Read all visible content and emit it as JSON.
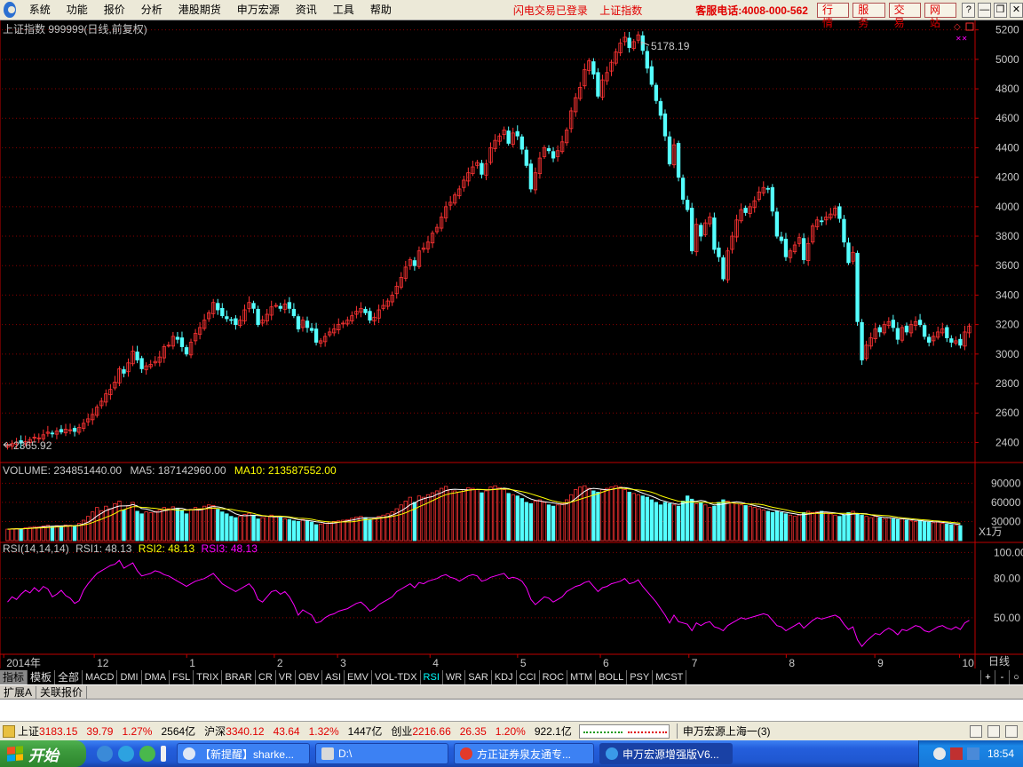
{
  "menu": {
    "items": [
      "系统",
      "功能",
      "报价",
      "分析",
      "港股期货",
      "申万宏源",
      "资讯",
      "工具",
      "帮助"
    ],
    "status_login": "闪电交易已登录",
    "status_index": "上证指数",
    "hotline": "客服电话:4008-000-562",
    "quick": [
      "行情",
      "服务",
      "交易",
      "网站"
    ],
    "window_buttons": [
      "?",
      "—",
      "❐",
      "✕"
    ]
  },
  "chart_header": {
    "title": "上证指数 999999(日线,前复权)",
    "high_label": "5178.19",
    "low_label": "2365.92",
    "volume_line": {
      "vol": "VOLUME: 234851440.00",
      "ma5": "MA5: 187142960.00",
      "ma10": "MA10: 213587552.00"
    },
    "rsi_line": {
      "name": "RSI(14,14,14)",
      "rsi1": "RSI1: 48.13",
      "rsi2": "RSI2: 48.13",
      "rsi3": "RSI3: 48.13"
    },
    "vol_unit": "X1万",
    "period": "日线"
  },
  "colors": {
    "up": "#ff3333",
    "down": "#54ffff",
    "grid": "#8b0000",
    "axis": "#c00000",
    "ma5": "#ffffff",
    "ma10": "#ffff00",
    "rsi": "#ff00ff"
  },
  "chart_data": [
    {
      "type": "candlestick",
      "title": "上证指数 999999(日线,前复权)",
      "y_ticks": [
        2400,
        2600,
        2800,
        3000,
        3200,
        3400,
        3600,
        3800,
        4000,
        4200,
        4400,
        4600,
        4800,
        5000,
        5200
      ],
      "ylim": [
        2270,
        5240
      ],
      "x_labels": [
        "2014年",
        "12",
        "1",
        "2",
        "3",
        "4",
        "5",
        "6",
        "7",
        "8",
        "9",
        "10"
      ],
      "high": 5178.19,
      "low": 2365.92,
      "closes": [
        2380,
        2392,
        2402,
        2396,
        2405,
        2420,
        2436,
        2431,
        2452,
        2470,
        2462,
        2478,
        2471,
        2490,
        2486,
        2475,
        2502,
        2530,
        2560,
        2590,
        2640,
        2680,
        2730,
        2760,
        2810,
        2900,
        2870,
        2940,
        3020,
        2960,
        2900,
        2920,
        2930,
        2950,
        2980,
        3050,
        3060,
        3120,
        3100,
        3050,
        3000,
        3080,
        3140,
        3180,
        3230,
        3280,
        3350,
        3300,
        3260,
        3240,
        3230,
        3200,
        3230,
        3300,
        3350,
        3310,
        3200,
        3230,
        3270,
        3320,
        3330,
        3310,
        3340,
        3310,
        3260,
        3170,
        3230,
        3180,
        3160,
        3080,
        3090,
        3120,
        3150,
        3170,
        3200,
        3210,
        3230,
        3260,
        3290,
        3310,
        3280,
        3230,
        3250,
        3300,
        3330,
        3360,
        3400,
        3460,
        3520,
        3590,
        3640,
        3600,
        3700,
        3720,
        3760,
        3820,
        3860,
        3930,
        4000,
        4030,
        4080,
        4120,
        4180,
        4230,
        4270,
        4300,
        4220,
        4290,
        4400,
        4450,
        4480,
        4520,
        4430,
        4500,
        4480,
        4390,
        4280,
        4120,
        4230,
        4330,
        4400,
        4380,
        4330,
        4380,
        4440,
        4520,
        4650,
        4740,
        4810,
        4930,
        4990,
        4900,
        4750,
        4860,
        4910,
        4980,
        5050,
        5110,
        5150,
        5080,
        5120,
        5166,
        5060,
        4940,
        4830,
        4720,
        4620,
        4480,
        4290,
        4420,
        4200,
        4050,
        3980,
        3700,
        3880,
        3800,
        3890,
        3930,
        3710,
        3660,
        3510,
        3700,
        3800,
        3910,
        3980,
        3960,
        4000,
        4040,
        4100,
        4130,
        4120,
        3970,
        3800,
        3770,
        3660,
        3700,
        3740,
        3790,
        3640,
        3750,
        3870,
        3910,
        3900,
        3930,
        3950,
        3990,
        3920,
        3760,
        3620,
        3690,
        3220,
        2960,
        3060,
        3110,
        3170,
        3150,
        3200,
        3220,
        3180,
        3100,
        3180,
        3150,
        3200,
        3220,
        3200,
        3120,
        3080,
        3120,
        3150,
        3170,
        3110,
        3080,
        3090,
        3060,
        3150,
        3190
      ]
    },
    {
      "type": "bar",
      "title": "VOLUME",
      "y_ticks": [
        30000,
        60000,
        90000
      ],
      "ylim": [
        0,
        96000
      ],
      "unit": "X1万",
      "values": [
        18000,
        18500,
        19000,
        18200,
        20000,
        21000,
        22000,
        21500,
        23000,
        24000,
        22000,
        23500,
        22800,
        24500,
        24000,
        23000,
        27000,
        32000,
        38000,
        45000,
        52000,
        47000,
        54000,
        50000,
        58000,
        62000,
        48000,
        55000,
        60000,
        46000,
        42000,
        45000,
        44000,
        46000,
        48000,
        52000,
        50000,
        53000,
        51000,
        47000,
        42000,
        49000,
        52000,
        50000,
        54000,
        56000,
        55000,
        49000,
        45000,
        42000,
        38000,
        36000,
        38000,
        41000,
        43000,
        40000,
        34000,
        36000,
        38000,
        40000,
        38000,
        36000,
        34000,
        33000,
        31000,
        30000,
        33000,
        31000,
        29000,
        25000,
        26000,
        27000,
        29000,
        30000,
        31000,
        32000,
        33000,
        35000,
        37000,
        38000,
        36000,
        33000,
        35000,
        38000,
        40000,
        42000,
        45000,
        50000,
        56000,
        62000,
        68000,
        60000,
        70000,
        68000,
        72000,
        75000,
        78000,
        82000,
        85000,
        80000,
        78000,
        76000,
        80000,
        83000,
        82000,
        80000,
        75000,
        78000,
        84000,
        86000,
        83000,
        80000,
        74000,
        72000,
        70000,
        66000,
        60000,
        58000,
        62000,
        64000,
        60000,
        56000,
        54000,
        56000,
        58000,
        64000,
        72000,
        80000,
        84000,
        86000,
        82000,
        78000,
        76000,
        80000,
        82000,
        84000,
        86000,
        84000,
        80000,
        76000,
        74000,
        72000,
        70000,
        68000,
        64000,
        60000,
        56000,
        60000,
        58000,
        56000,
        54000,
        62000,
        70000,
        65000,
        58000,
        60000,
        56000,
        52000,
        54000,
        60000,
        64000,
        62000,
        60000,
        58000,
        56000,
        55000,
        54000,
        52000,
        50000,
        48000,
        46000,
        44000,
        46000,
        44000,
        42000,
        40000,
        38000,
        40000,
        44000,
        46000,
        44000,
        45000,
        46000,
        44000,
        42000,
        40000,
        38000,
        40000,
        44000,
        46000,
        42000,
        40000,
        38000,
        36000,
        38000,
        36000,
        34000,
        36000,
        34000,
        33000,
        34000,
        32000,
        31000,
        30000,
        31000,
        30000,
        29000,
        28000,
        29000,
        27000,
        26000,
        25000,
        24000,
        23485
      ]
    },
    {
      "type": "line",
      "title": "RSI(14,14,14)",
      "y_ticks": [
        50,
        80,
        100
      ],
      "ylim": [
        22,
        105
      ],
      "values": [
        62,
        66,
        64,
        68,
        71,
        69,
        73,
        70,
        74,
        72,
        66,
        68,
        71,
        67,
        65,
        61,
        63,
        71,
        76,
        80,
        84,
        86,
        88,
        90,
        91,
        94,
        88,
        90,
        92,
        86,
        82,
        83,
        84,
        86,
        85,
        83,
        82,
        80,
        78,
        76,
        74,
        76,
        78,
        79,
        80,
        82,
        84,
        80,
        76,
        74,
        72,
        70,
        72,
        74,
        76,
        72,
        64,
        62,
        66,
        70,
        71,
        68,
        70,
        66,
        60,
        52,
        56,
        54,
        52,
        46,
        47,
        50,
        52,
        53,
        55,
        56,
        57,
        59,
        61,
        62,
        59,
        55,
        57,
        60,
        62,
        64,
        66,
        70,
        72,
        74,
        76,
        73,
        77,
        76,
        78,
        79,
        80,
        82,
        83,
        81,
        80,
        78,
        80,
        82,
        83,
        82,
        78,
        79,
        81,
        82,
        83,
        84,
        80,
        81,
        80,
        78,
        73,
        64,
        60,
        63,
        66,
        65,
        62,
        64,
        66,
        70,
        72,
        74,
        75,
        77,
        78,
        74,
        70,
        73,
        74,
        76,
        77,
        78,
        80,
        76,
        77,
        79,
        74,
        70,
        66,
        62,
        57,
        52,
        46,
        52,
        47,
        46,
        45,
        40,
        46,
        44,
        46,
        47,
        43,
        42,
        40,
        44,
        46,
        48,
        50,
        49,
        50,
        51,
        52,
        53,
        52,
        48,
        44,
        43,
        40,
        42,
        44,
        46,
        42,
        45,
        48,
        50,
        49,
        50,
        51,
        52,
        50,
        45,
        41,
        43,
        33,
        28,
        32,
        35,
        38,
        37,
        40,
        42,
        40,
        37,
        41,
        40,
        42,
        44,
        43,
        40,
        39,
        41,
        43,
        44,
        42,
        41,
        43,
        41,
        46,
        48
      ]
    }
  ],
  "tabs": [
    "指标",
    "模板",
    "全部",
    "MACD",
    "DMI",
    "DMA",
    "FSL",
    "TRIX",
    "BRAR",
    "CR",
    "VR",
    "OBV",
    "ASI",
    "EMV",
    "VOL-TDX",
    "RSI",
    "WR",
    "SAR",
    "KDJ",
    "CCI",
    "ROC",
    "MTM",
    "BOLL",
    "PSY",
    "MCST"
  ],
  "tab_right": [
    "+",
    "-",
    "○"
  ],
  "ext_row": [
    "扩展A",
    "关联报价"
  ],
  "status": {
    "sh_name": "上证",
    "sh_val": "3183.15",
    "sh_chg": "39.79",
    "sh_pct": "1.27%",
    "sh_amt": "2564亿",
    "hs_name": "沪深",
    "hs_val": "3340.12",
    "hs_chg": "43.64",
    "hs_pct": "1.32%",
    "hs_amt": "1447亿",
    "cy_name": "创业",
    "cy_val": "2216.66",
    "cy_chg": "26.35",
    "cy_pct": "1.20%",
    "cy_amt": "922.1亿",
    "broker": "申万宏源上海一(3)"
  },
  "taskbar": {
    "start": "开始",
    "tasks": [
      "【新提醒】sharke...",
      "D:\\",
      "方正证券泉友通专...",
      "申万宏源增强版V6..."
    ],
    "clock": "18:54"
  }
}
